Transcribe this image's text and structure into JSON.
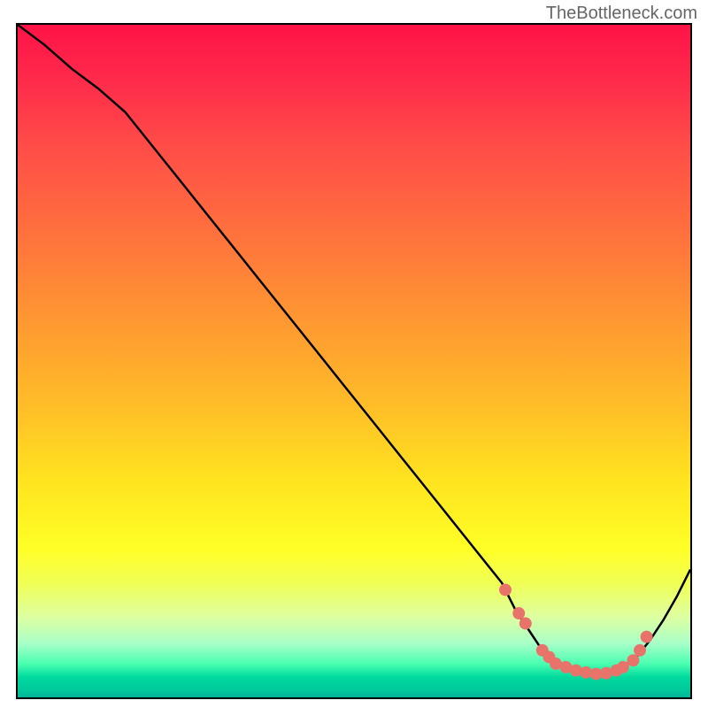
{
  "watermark": "TheBottleneck.com",
  "chart_data": {
    "type": "line",
    "title": "",
    "xlabel": "",
    "ylabel": "",
    "xlim": [
      0,
      100
    ],
    "ylim": [
      0,
      100
    ],
    "series": [
      {
        "name": "curve",
        "x": [
          0,
          4,
          8,
          12,
          16,
          20,
          24,
          28,
          32,
          36,
          40,
          44,
          48,
          52,
          56,
          60,
          64,
          68,
          72,
          74,
          76,
          78,
          80,
          82,
          84,
          86,
          88,
          90,
          92,
          94,
          96,
          98,
          100
        ],
        "y": [
          100,
          97,
          93.5,
          90.5,
          87,
          82,
          77,
          72,
          67,
          62,
          57,
          52,
          47,
          42,
          37,
          32,
          27,
          22,
          17,
          13,
          10,
          7,
          5,
          4,
          3.5,
          3.3,
          3.5,
          4.5,
          6,
          8.5,
          11.5,
          15,
          19
        ]
      }
    ],
    "dots": {
      "x": [
        72.5,
        74.5,
        75.5,
        78,
        79,
        80,
        81.5,
        83,
        84.5,
        86,
        87.5,
        89,
        90,
        91.5,
        92.5,
        93.5
      ],
      "y": [
        16,
        12.5,
        11,
        7,
        6,
        5,
        4.5,
        4,
        3.7,
        3.5,
        3.6,
        4,
        4.5,
        5.5,
        7,
        9
      ]
    },
    "gradient_stops": [
      {
        "pct": 0,
        "color": "#ff1348"
      },
      {
        "pct": 18,
        "color": "#ff4c48"
      },
      {
        "pct": 42,
        "color": "#ff9233"
      },
      {
        "pct": 68,
        "color": "#ffe41f"
      },
      {
        "pct": 83,
        "color": "#f0ff55"
      },
      {
        "pct": 95,
        "color": "#4affb0"
      },
      {
        "pct": 100,
        "color": "#00b396"
      }
    ]
  }
}
